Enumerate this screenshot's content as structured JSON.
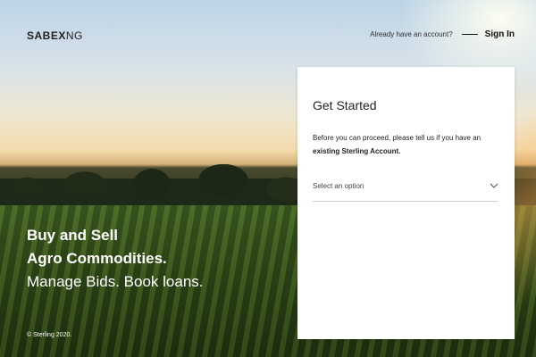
{
  "brand": {
    "logo_bold": "SABEX",
    "logo_light": "NG"
  },
  "header": {
    "prompt": "Already have an account?",
    "signin_label": "Sign In"
  },
  "hero": {
    "line1": "Buy and Sell",
    "line2": "Agro Commodities.",
    "line3": "Manage Bids. Book loans."
  },
  "footer": {
    "copyright": "© Sterling 2020."
  },
  "card": {
    "title": "Get Started",
    "desc_prefix": "Before you can proceed, please tell us if you have an",
    "desc_bold": "existing Sterling Account.",
    "select": {
      "placeholder": "Select an option",
      "icon": "chevron-down-icon"
    }
  }
}
